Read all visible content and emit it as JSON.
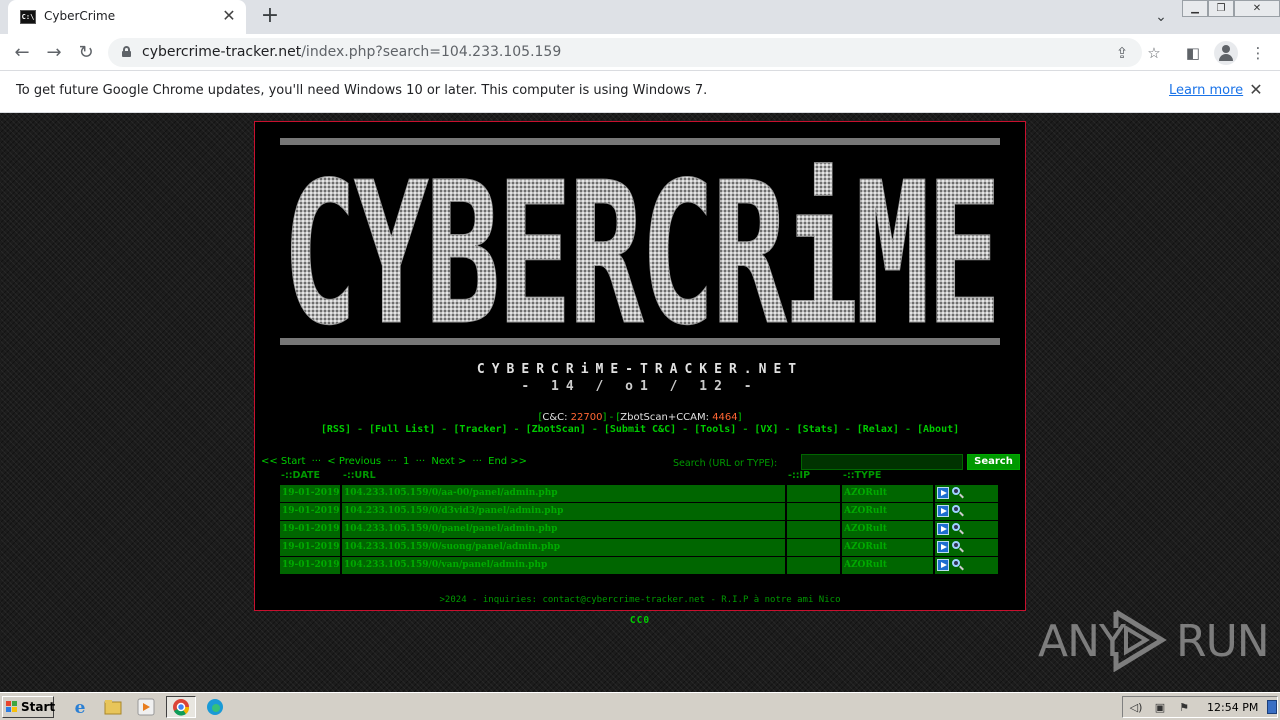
{
  "browser": {
    "tab_title": "CyberCrime",
    "tab_favicon_text": "C:\\",
    "url_host": "cybercrime-tracker.net",
    "url_path": "/index.php?search=104.233.105.159"
  },
  "infobar": {
    "message": "To get future Google Chrome updates, you'll need Windows 10 or later. This computer is using Windows 7.",
    "link": "Learn more"
  },
  "site": {
    "logo_text": "CYBERCRiME",
    "name": "CYBERCRiME-TRACKER.NET",
    "date": "- 14 / o1 / 12 -",
    "stats": {
      "cc_label": "C&C:",
      "cc_value": "22700",
      "zbot_label": "ZbotScan+CCAM:",
      "zbot_value": "4464"
    },
    "nav": [
      "[RSS]",
      "[Full List]",
      "[Tracker]",
      "[ZbotScan]",
      "[Submit C&C]",
      "[Tools]",
      "[VX]",
      "[Stats]",
      "[Relax]",
      "[About]"
    ],
    "pager": [
      "<< Start",
      "···",
      "< Previous",
      "···",
      "1",
      "···",
      "Next >",
      "···",
      "End >>"
    ],
    "search_label": "Search (URL or TYPE):",
    "search_value": "",
    "search_button": "Search",
    "columns": {
      "date": "-::DATE",
      "url": "-::URL",
      "ip": "-::IP",
      "type": "-::TYPE"
    },
    "rows": [
      {
        "date": "19-01-2019",
        "url": "104.233.105.159/0/aa-00/panel/admin.php",
        "ip": "",
        "type": "AZORult"
      },
      {
        "date": "19-01-2019",
        "url": "104.233.105.159/0/d3vid3/panel/admin.php",
        "ip": "",
        "type": "AZORult"
      },
      {
        "date": "19-01-2019",
        "url": "104.233.105.159/0/panel/panel/admin.php",
        "ip": "",
        "type": "AZORult"
      },
      {
        "date": "19-01-2019",
        "url": "104.233.105.159/0/suong/panel/admin.php",
        "ip": "",
        "type": "AZORult"
      },
      {
        "date": "19-01-2019",
        "url": "104.233.105.159/0/van/panel/admin.php",
        "ip": "",
        "type": "AZORult"
      }
    ],
    "footer": ">2024 - inquiries: contact@cybercrime-tracker.net - R.I.P à notre ami Nico",
    "license": "CC0"
  },
  "watermark": {
    "left": "ANY",
    "right": "RUN"
  },
  "taskbar": {
    "start_label": "Start",
    "clock": "12:54 PM",
    "apps": [
      "ie-icon",
      "explorer-icon",
      "media-player-icon",
      "chrome-icon",
      "edge-icon"
    ]
  },
  "colors": {
    "accent_green": "#00cc00",
    "row_green": "#006600",
    "frame_red": "#c8102e",
    "count_orange": "#ff6633"
  }
}
